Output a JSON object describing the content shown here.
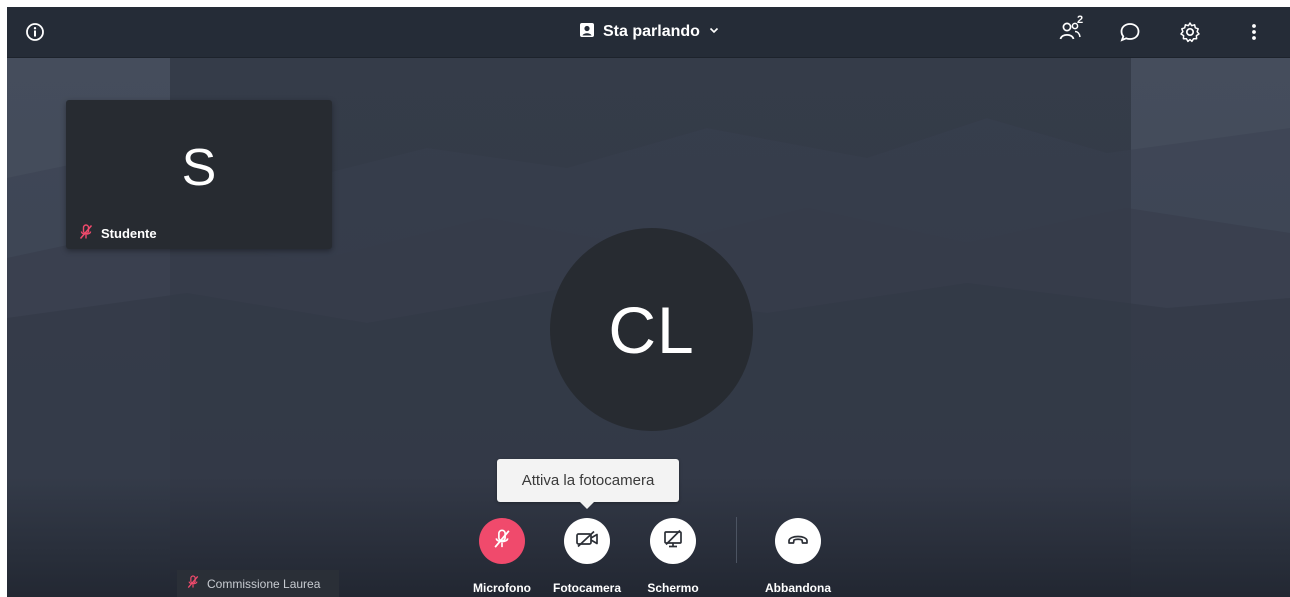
{
  "topbar": {
    "info_icon": "info-circle-icon",
    "layout_label": "Sta parlando",
    "layout_icon": "speaker-view-icon",
    "chevron_icon": "chevron-down-icon",
    "participants_icon": "people-icon",
    "participants_count": "2",
    "chat_icon": "chat-bubble-icon",
    "settings_icon": "gear-icon",
    "more_icon": "vertical-ellipsis-icon"
  },
  "thumbnail": {
    "initial": "S",
    "name": "Studente",
    "mic_status_icon": "mic-off-icon"
  },
  "main_speaker": {
    "initials": "CL"
  },
  "local_participant": {
    "name": "Commissione Laurea",
    "mic_status_icon": "mic-off-icon"
  },
  "tooltip": {
    "text": "Attiva la fotocamera"
  },
  "controls": {
    "microphone": {
      "label": "Microfono",
      "icon": "mic-off-icon",
      "state": "muted"
    },
    "camera": {
      "label": "Fotocamera",
      "icon": "camera-off-icon"
    },
    "screen": {
      "label": "Schermo",
      "icon": "screen-share-off-icon"
    },
    "leave": {
      "label": "Abbandona",
      "icon": "hang-up-icon"
    }
  },
  "colors": {
    "topbar": "#252c37",
    "stage": "#333a47",
    "tile": "#272b31",
    "muted_accent": "#f04a6c"
  }
}
